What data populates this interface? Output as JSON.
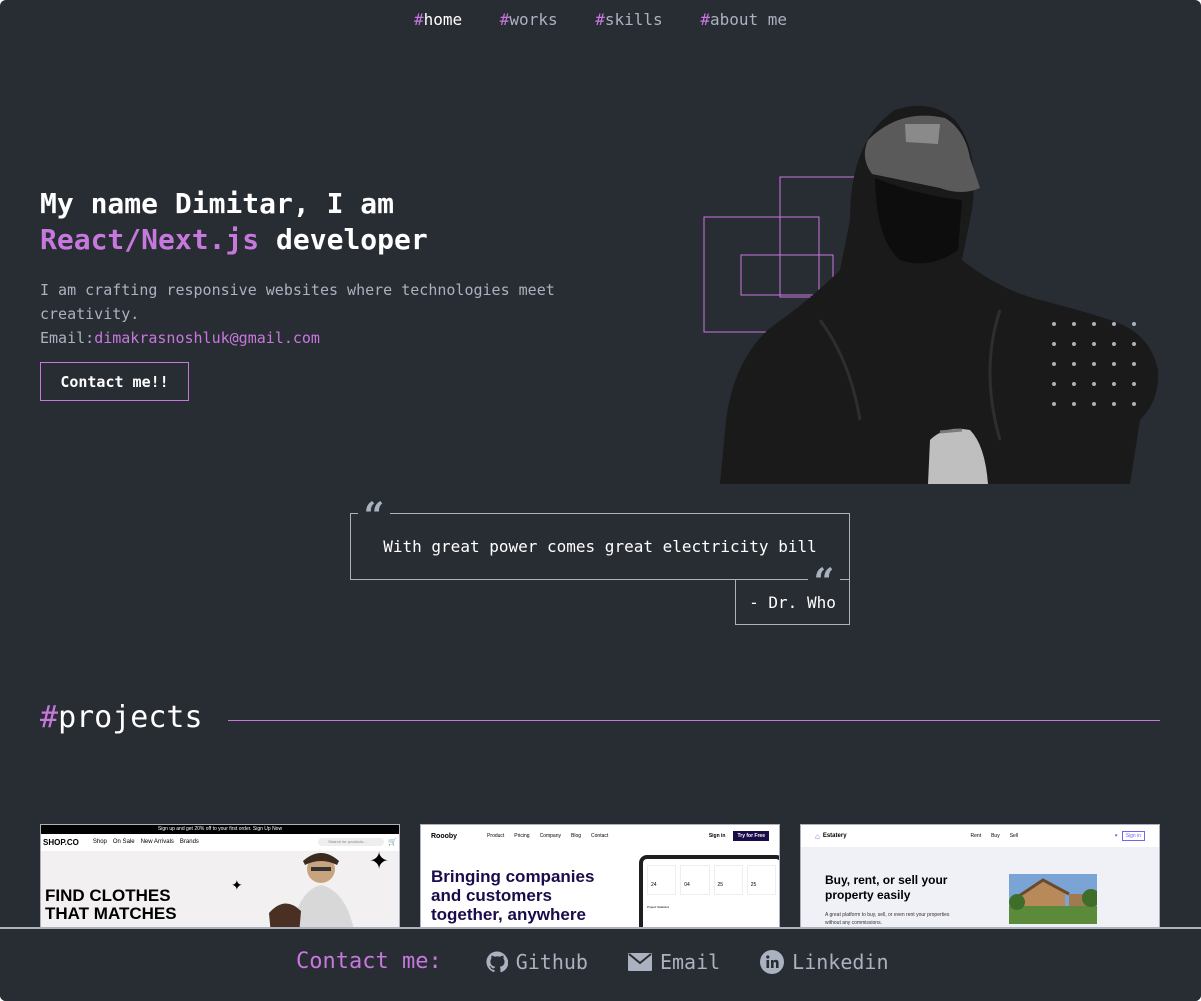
{
  "nav": {
    "hash": "#",
    "items": [
      {
        "label": "home",
        "active": true
      },
      {
        "label": "works",
        "active": false
      },
      {
        "label": "skills",
        "active": false
      },
      {
        "label": "about me",
        "active": false
      }
    ]
  },
  "hero": {
    "title_line1": "My name Dimitar, I am",
    "title_accent": "React/Next.js",
    "title_rest": "developer",
    "description": "I am crafting responsive websites where technologies meet creativity.",
    "email_label": "Email:",
    "email": "dimakrasnoshluk@gmail.com",
    "contact_button": "Contact me!!"
  },
  "quote": {
    "text": "With great power comes great electricity bill",
    "author": "- Dr. Who",
    "mark": "“"
  },
  "projects": {
    "hash": "#",
    "title": "projects",
    "cards": [
      {
        "banner": "Sign up and get 20% off to your first order. Sign Up Now",
        "brand": "SHOP.CO",
        "menu": [
          "Shop",
          "On Sale",
          "New Arrivals",
          "Brands"
        ],
        "search": "Search for products...",
        "headline": "FIND CLOTHES THAT MATCHES"
      },
      {
        "brand": "Roooby",
        "menu": [
          "Product",
          "Pricing",
          "Company",
          "Blog",
          "Contact"
        ],
        "signin": "Sign in",
        "cta": "Try for Free",
        "headline": "Bringing companies and customers together, anywhere",
        "stats": [
          "24",
          "04",
          "25",
          "25"
        ],
        "panel": "Project Statistics"
      },
      {
        "brand": "Estatery",
        "menu": [
          "Rent",
          "Buy",
          "Sell"
        ],
        "signin": "Sign in",
        "headline": "Buy, rent, or sell your property easily",
        "sub": "A great platform to buy, sell, or even rent your properties without any commissions."
      }
    ]
  },
  "footer": {
    "label": "Contact me:",
    "links": [
      {
        "label": "Github",
        "icon": "github-icon"
      },
      {
        "label": "Email",
        "icon": "email-icon"
      },
      {
        "label": "Linkedin",
        "icon": "linkedin-icon"
      }
    ]
  },
  "colors": {
    "background": "#282c33",
    "accent": "#c778dd",
    "muted": "#abb2bf",
    "text": "#ffffff"
  }
}
